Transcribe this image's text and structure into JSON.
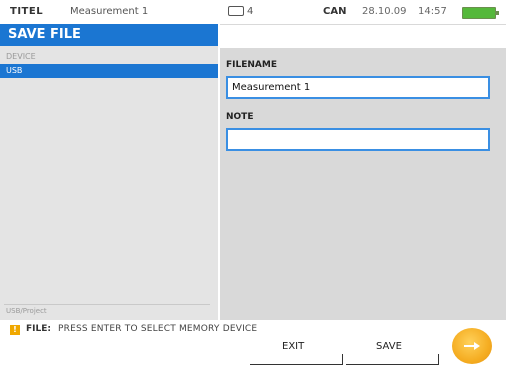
{
  "topbar": {
    "title_key": "TITEL",
    "title_value": "Measurement 1",
    "conn_text": "4",
    "faded_text": "",
    "can_label": "CAN",
    "date": "28.10.09",
    "time": "14:57"
  },
  "left_panel": {
    "header": "SAVE FILE",
    "device_label": "DEVICE",
    "devices": [
      {
        "label": "USB",
        "selected": true
      }
    ],
    "path": "USB/Project"
  },
  "right_panel": {
    "filename_label": "FILENAME",
    "filename_value": "Measurement 1",
    "note_label": "NOTE",
    "note_value": ""
  },
  "status": {
    "icon": "warning-icon",
    "key": "FILE:",
    "message": "PRESS ENTER TO SELECT MEMORY DEVICE"
  },
  "softkeys": {
    "exit": "EXIT",
    "save": "SAVE"
  },
  "colors": {
    "accent_blue": "#1b76d2",
    "input_border": "#3a8fe3",
    "battery_green": "#55b83a",
    "enter_orange": "#f5ad22"
  }
}
